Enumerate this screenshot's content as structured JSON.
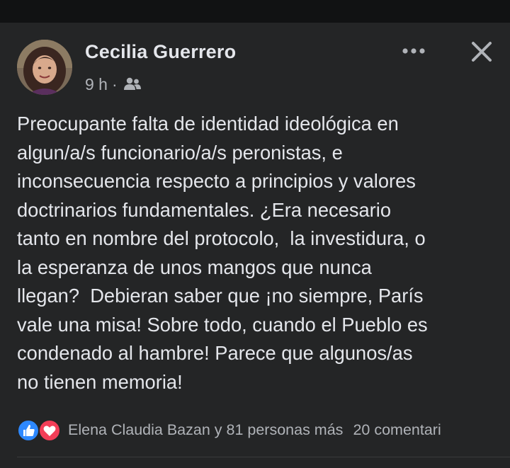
{
  "post": {
    "author": "Cecilia Guerrero",
    "time": "9 h",
    "separator": "·",
    "audience_icon": "friends-icon",
    "text": "Preocupante falta de identidad ideológica en\nalgun/a/s funcionario/a/s peronistas, e\ninconsecuencia respecto a principios y valores\ndoctrinarios fundamentales. ¿Era necesario\ntanto en nombre del protocolo,  la investidura, o\nla esperanza de unos mangos que nunca\nllegan?  Debieran saber que ¡no siempre, París\nvale una misa! Sobre todo, cuando el Pueblo es\ncondenado al hambre! Parece que algunos/as\nno tienen memoria!"
  },
  "reactions": {
    "icons": [
      "like-icon",
      "love-icon"
    ],
    "names": "Elena Claudia Bazan y 81 personas más",
    "comments": "20 comentari"
  },
  "header_icons": [
    "more-options-icon",
    "close-icon"
  ],
  "colors": {
    "background": "#18191a",
    "card": "#242526",
    "text_primary": "#e4e6eb",
    "text_secondary": "#b0b3b8",
    "like_blue": "#2d88ff",
    "love_red": "#f33e58"
  }
}
